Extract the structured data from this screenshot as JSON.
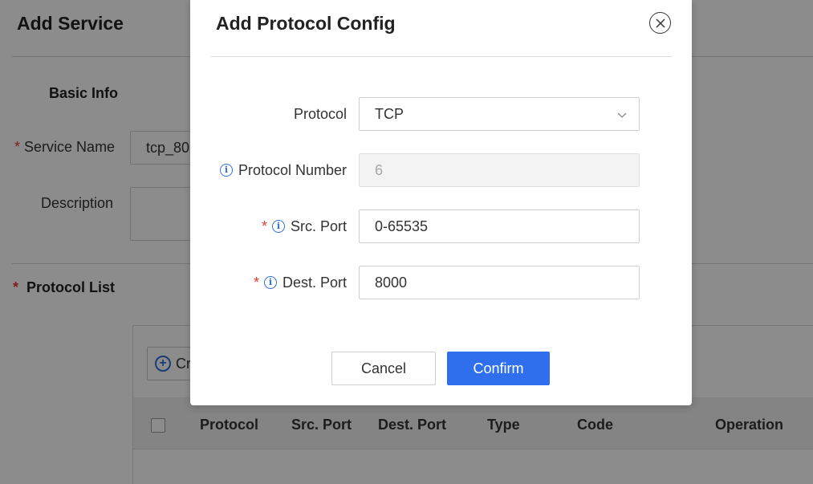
{
  "page": {
    "title": "Add Service",
    "basic_info": "Basic Info",
    "service_name": {
      "label": "Service Name",
      "value": "tcp_80"
    },
    "description": {
      "label": "Description",
      "value": ""
    },
    "protocol_list": "Protocol List",
    "create_button": "Cr",
    "table": {
      "columns": [
        "Protocol",
        "Src. Port",
        "Dest. Port",
        "Type",
        "Code",
        "Operation"
      ]
    }
  },
  "modal": {
    "title": "Add Protocol Config",
    "close_icon": "close-circle-icon",
    "fields": {
      "protocol": {
        "label": "Protocol",
        "value": "TCP"
      },
      "protocol_number": {
        "label": "Protocol Number",
        "value": "6"
      },
      "src_port": {
        "label": "Src. Port",
        "value": "0-65535"
      },
      "dest_port": {
        "label": "Dest. Port",
        "value": "8000"
      }
    },
    "required_mark": "*",
    "cancel_label": "Cancel",
    "confirm_label": "Confirm"
  },
  "colors": {
    "primary": "#2f6fed",
    "required": "#e53935",
    "info": "#2f6fdc"
  }
}
